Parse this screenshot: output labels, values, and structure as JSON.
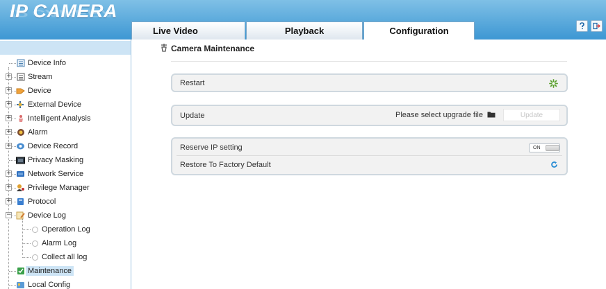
{
  "app": {
    "logo": "IP CAMERA"
  },
  "tabs": [
    {
      "label": "Live Video"
    },
    {
      "label": "Playback"
    },
    {
      "label": "Configuration",
      "active": true
    }
  ],
  "header_buttons": [
    {
      "icon": "help-icon",
      "glyph": "?"
    },
    {
      "icon": "logout-icon",
      "glyph": "⇥"
    }
  ],
  "sidebar": {
    "items": [
      {
        "label": "Device Info",
        "icon": "device-info-icon",
        "expandable": false
      },
      {
        "label": "Stream",
        "icon": "stream-icon",
        "expandable": true
      },
      {
        "label": "Device",
        "icon": "device-icon",
        "expandable": true
      },
      {
        "label": "External Device",
        "icon": "external-device-icon",
        "expandable": true
      },
      {
        "label": "Intelligent Analysis",
        "icon": "intelligent-analysis-icon",
        "expandable": true
      },
      {
        "label": "Alarm",
        "icon": "alarm-icon",
        "expandable": true
      },
      {
        "label": "Device Record",
        "icon": "device-record-icon",
        "expandable": true
      },
      {
        "label": "Privacy Masking",
        "icon": "privacy-masking-icon",
        "expandable": false
      },
      {
        "label": "Network Service",
        "icon": "network-service-icon",
        "expandable": true
      },
      {
        "label": "Privilege Manager",
        "icon": "privilege-manager-icon",
        "expandable": true
      },
      {
        "label": "Protocol",
        "icon": "protocol-icon",
        "expandable": true
      },
      {
        "label": "Device Log",
        "icon": "device-log-icon",
        "expandable": true,
        "expanded": true
      },
      {
        "label": "Operation Log",
        "sub": true
      },
      {
        "label": "Alarm Log",
        "sub": true
      },
      {
        "label": "Collect all log",
        "sub": true
      },
      {
        "label": "Maintenance",
        "icon": "maintenance-icon",
        "expandable": false,
        "selected": true
      },
      {
        "label": "Local Config",
        "icon": "local-config-icon",
        "expandable": false
      }
    ]
  },
  "main": {
    "title": "Camera Maintenance",
    "restart": {
      "label": "Restart"
    },
    "update": {
      "label": "Update",
      "prompt": "Please select upgrade file",
      "button": "Update"
    },
    "reserve_ip": {
      "label": "Reserve IP setting",
      "toggle": "ON"
    },
    "factory_default": {
      "label": "Restore To Factory Default"
    }
  },
  "colors": {
    "header_top": "#7fc0e6",
    "header_bottom": "#3d97d3",
    "sidebar_highlight": "#cde4f5",
    "restart_icon": "#5aa02c",
    "factory_icon": "#2a8dd4"
  }
}
